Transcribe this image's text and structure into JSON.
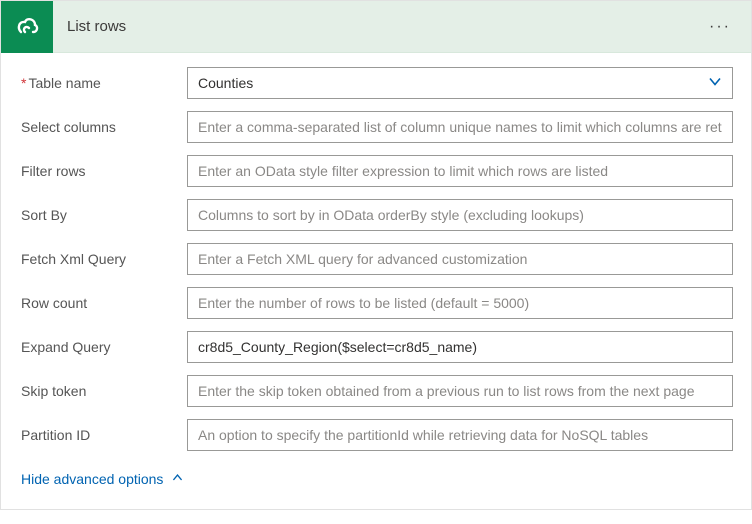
{
  "header": {
    "title": "List rows"
  },
  "fields": {
    "table_name": {
      "label": "Table name",
      "value": "Counties",
      "required": true
    },
    "select_columns": {
      "label": "Select columns",
      "placeholder": "Enter a comma-separated list of column unique names to limit which columns are returned"
    },
    "filter_rows": {
      "label": "Filter rows",
      "placeholder": "Enter an OData style filter expression to limit which rows are listed"
    },
    "sort_by": {
      "label": "Sort By",
      "placeholder": "Columns to sort by in OData orderBy style (excluding lookups)"
    },
    "fetch_xml": {
      "label": "Fetch Xml Query",
      "placeholder": "Enter a Fetch XML query for advanced customization"
    },
    "row_count": {
      "label": "Row count",
      "placeholder": "Enter the number of rows to be listed (default = 5000)"
    },
    "expand_query": {
      "label": "Expand Query",
      "value": "cr8d5_County_Region($select=cr8d5_name)"
    },
    "skip_token": {
      "label": "Skip token",
      "placeholder": "Enter the skip token obtained from a previous run to list rows from the next page"
    },
    "partition_id": {
      "label": "Partition ID",
      "placeholder": "An option to specify the partitionId while retrieving data for NoSQL tables"
    }
  },
  "footer": {
    "hide_advanced": "Hide advanced options"
  }
}
